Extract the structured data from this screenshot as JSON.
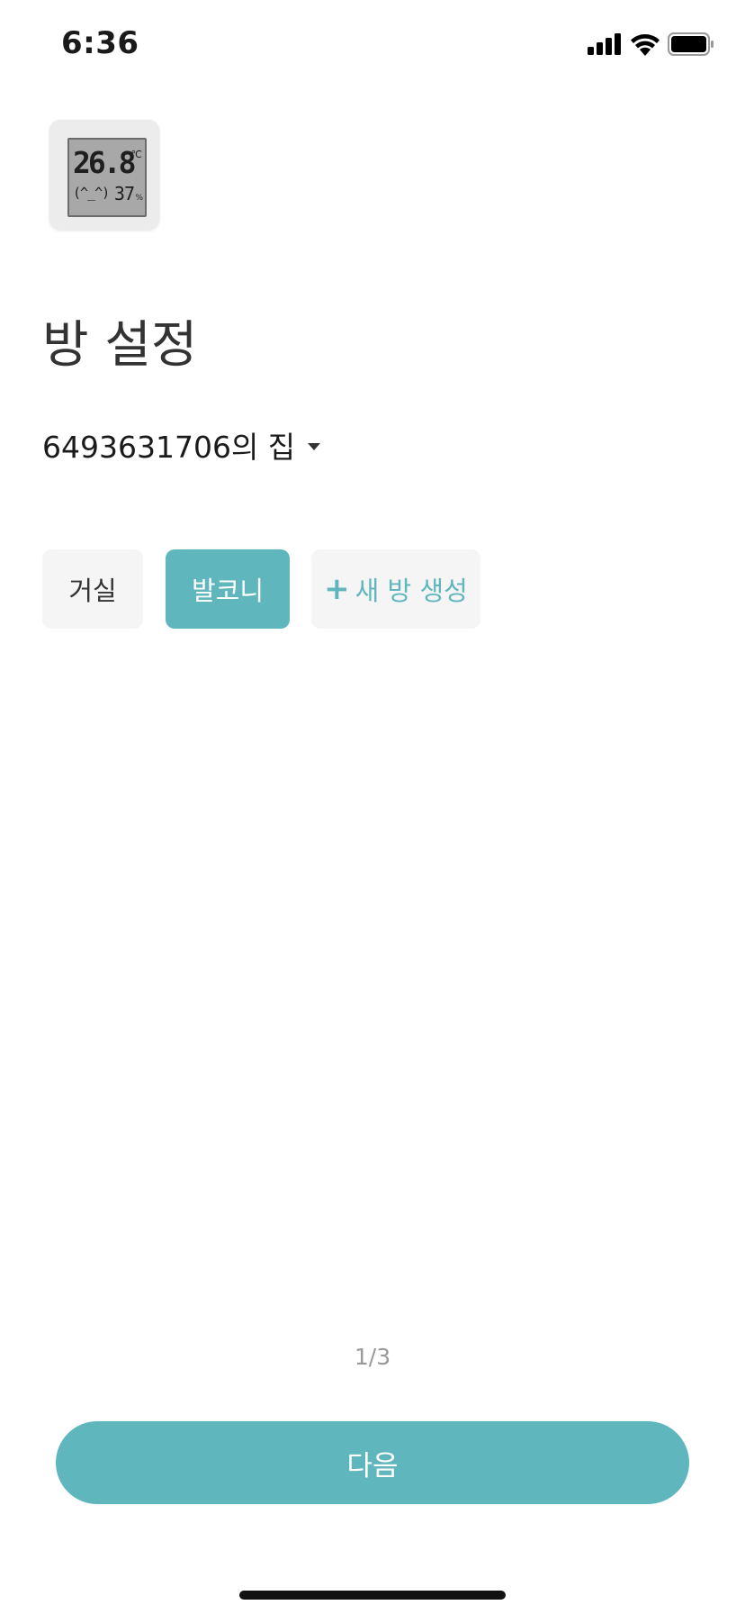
{
  "status_bar": {
    "time": "6:36",
    "icons": [
      "cellular-signal-icon",
      "wifi-icon",
      "battery-icon"
    ]
  },
  "device": {
    "icon": "thermo-hygrometer-icon",
    "screen_temperature": "26.8",
    "screen_temperature_unit": "℃",
    "screen_face": "(^_^)",
    "screen_humidity": "37",
    "screen_humidity_unit": "%"
  },
  "page": {
    "title": "방 설정"
  },
  "home_selector": {
    "label": "6493631706의 집",
    "icon": "dropdown-caret-icon"
  },
  "rooms": {
    "items": [
      {
        "label": "거실",
        "selected": false
      },
      {
        "label": "발코니",
        "selected": true
      }
    ],
    "new_room_plus": "+",
    "new_room_label": "새 방 생성"
  },
  "footer": {
    "pager": "1/3",
    "next_label": "다음"
  },
  "colors": {
    "accent": "#5fb7bd",
    "chip_bg": "#f5f5f5",
    "text_primary": "#1a1a1a",
    "text_muted": "#999999"
  }
}
